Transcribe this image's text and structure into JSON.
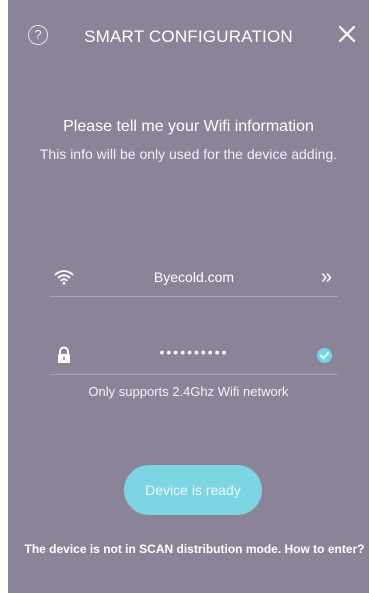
{
  "header": {
    "title": "SMART CONFIGURATION",
    "help_icon_glyph": "?",
    "help_icon": "help-circle-icon",
    "close_icon": "close-icon"
  },
  "intro": {
    "title": "Please tell me your Wifi information",
    "subtitle": "This info will be only used for the device adding."
  },
  "wifi_row": {
    "icon": "wifi-icon",
    "ssid": "Byecold.com",
    "action_glyph": "»",
    "action_icon": "double-chevron-right-icon"
  },
  "password_row": {
    "icon": "lock-icon",
    "masked_value": "••••••••••",
    "status_icon": "check-circle-icon"
  },
  "hint": "Only supports 2.4Ghz Wifi network",
  "primary_button": {
    "label": "Device is ready"
  },
  "footer_link": "The device is not in SCAN distribution mode. How to enter?",
  "colors": {
    "background": "#8b8398",
    "accent": "#7dd5e3",
    "check": "#6fd6e6",
    "text": "#ffffff"
  }
}
